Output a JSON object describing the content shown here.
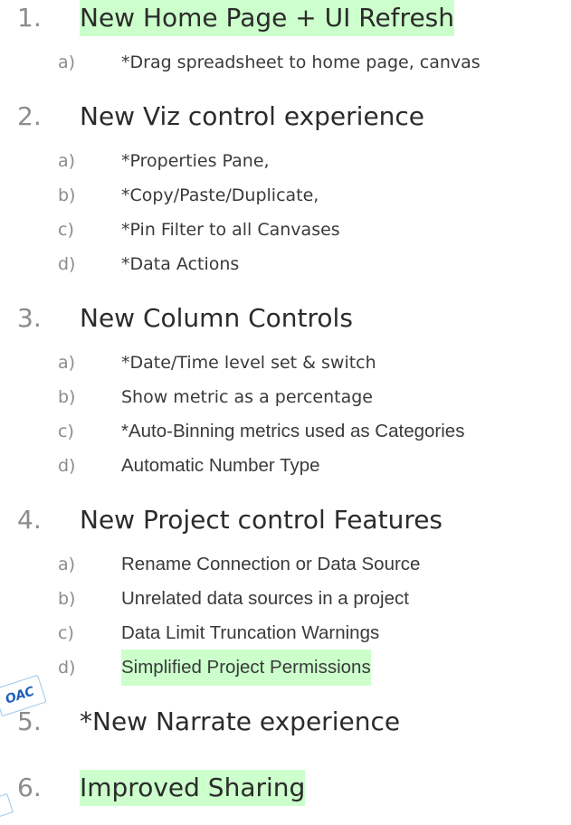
{
  "sections": [
    {
      "number": "1.",
      "title": "New Home Page + UI Refresh",
      "highlight": true,
      "items": [
        {
          "letter": "a)",
          "text": "*Drag spreadsheet to home page, canvas"
        }
      ]
    },
    {
      "number": "2.",
      "title": "New Viz control experience",
      "highlight": false,
      "items": [
        {
          "letter": "a)",
          "text": "*Properties Pane,"
        },
        {
          "letter": "b)",
          "text": "*Copy/Paste/Duplicate,"
        },
        {
          "letter": "c)",
          "text": "*Pin Filter to all Canvases"
        },
        {
          "letter": "d)",
          "text": "*Data Actions"
        }
      ]
    },
    {
      "number": "3.",
      "title": "New Column Controls",
      "highlight": false,
      "items": [
        {
          "letter": "a)",
          "text": "*Date/Time level set & switch"
        },
        {
          "letter": "b)",
          "text": "Show metric as  a percentage"
        },
        {
          "letter": "c)",
          "text": "*Auto-Binning metrics used as Categories"
        },
        {
          "letter": "d)",
          "text": "Automatic Number Type"
        }
      ]
    },
    {
      "number": "4.",
      "title": "New Project control Features",
      "highlight": false,
      "items": [
        {
          "letter": "a)",
          "text": "Rename Connection or Data Source"
        },
        {
          "letter": "b)",
          "text": "Unrelated data sources in a  project"
        },
        {
          "letter": "c)",
          "text": "Data Limit Truncation Warnings"
        },
        {
          "letter": "d)",
          "text": "Simplified Project Permissions",
          "highlight": true
        }
      ]
    },
    {
      "number": "5.",
      "title": "*New Narrate experience",
      "highlight": false,
      "items": []
    },
    {
      "number": "6.",
      "title": "Improved Sharing",
      "highlight": true,
      "items": []
    }
  ],
  "badge": {
    "label": "OAC"
  },
  "colors": {
    "highlight": "#ccffcc",
    "badge_text": "#1f5fbf",
    "badge_border": "#9ec6ea"
  }
}
